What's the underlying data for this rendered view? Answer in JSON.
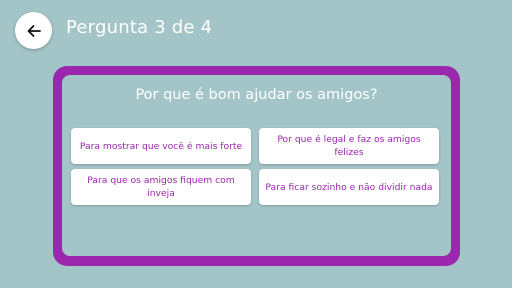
{
  "header": {
    "back_icon": "arrow-left-icon",
    "title": "Pergunta 3 de 4"
  },
  "quiz": {
    "question": "Por que é bom ajudar os amigos?",
    "answers": [
      {
        "label": "Para mostrar que você é mais forte"
      },
      {
        "label": "Por que é legal e faz os amigos felizes"
      },
      {
        "label": "Para que os amigos fiquem com inveja"
      },
      {
        "label": "Para ficar sozinho e não dividir nada"
      }
    ]
  },
  "colors": {
    "background": "#a3c5c8",
    "accent": "#9a27ad",
    "card_surface": "#ffffff",
    "title_text": "#ffffff"
  }
}
